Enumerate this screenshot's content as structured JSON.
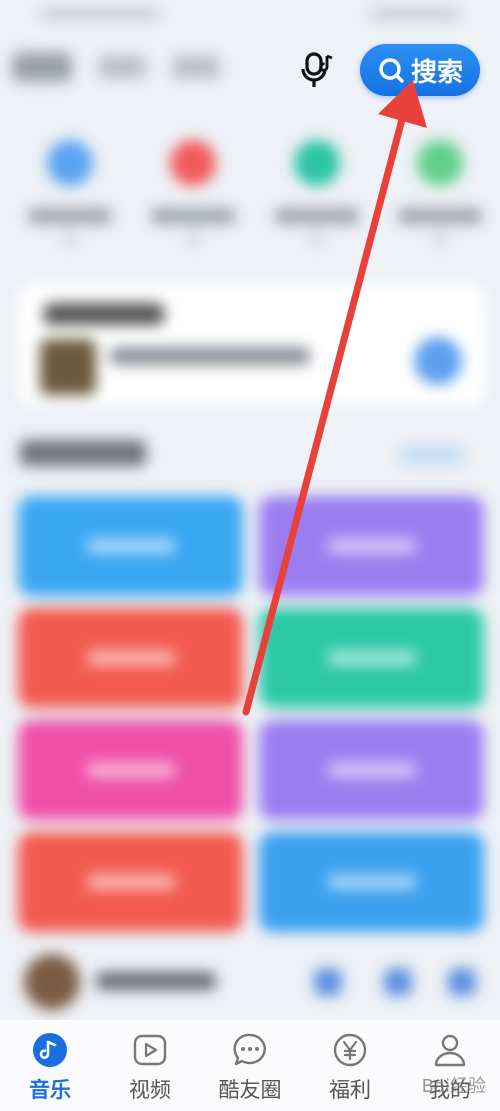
{
  "header": {
    "search_label": "搜索"
  },
  "bottom_nav": {
    "items": [
      {
        "label": "音乐",
        "icon": "music-note-icon",
        "active": true
      },
      {
        "label": "视频",
        "icon": "video-play-icon",
        "active": false
      },
      {
        "label": "酷友圈",
        "icon": "chat-bubble-icon",
        "active": false
      },
      {
        "label": "福利",
        "icon": "yuan-coin-icon",
        "active": false
      },
      {
        "label": "我的",
        "icon": "user-icon",
        "active": false
      }
    ]
  },
  "watermark": "Bai经验",
  "colors": {
    "accent": "#1a6fe0",
    "arrow": "#e8403a",
    "tile_colors": [
      "#3aa7f2",
      "#9b7df0",
      "#f25a4e",
      "#2cc8a8",
      "#f050a8",
      "#9b7df0",
      "#f25a4e",
      "#3aa0f0"
    ]
  }
}
